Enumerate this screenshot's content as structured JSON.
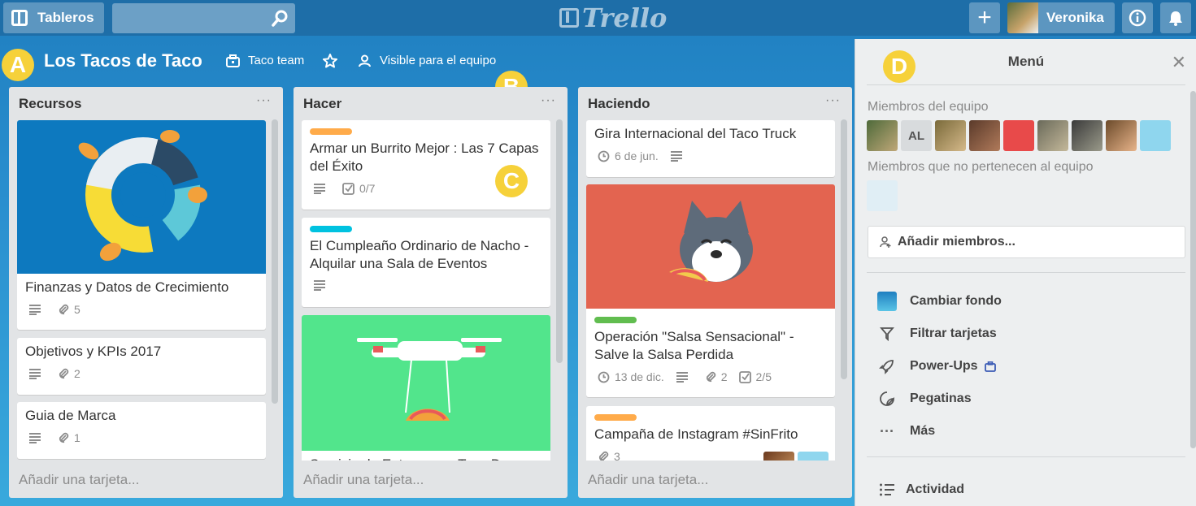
{
  "topbar": {
    "boards_label": "Tableros",
    "search_placeholder": "",
    "logo_text": "Trello",
    "user_name": "Veronika"
  },
  "board": {
    "title": "Los Tacos de Taco",
    "team": "Taco team",
    "visibility": "Visible para el equipo"
  },
  "badges": {
    "a": "A",
    "b": "B",
    "c": "C",
    "d": "D"
  },
  "lists": [
    {
      "title": "Recursos",
      "add_card": "Añadir una tarjeta...",
      "cards": [
        {
          "title": "Finanzas y Datos de Crecimiento",
          "attachments": "5"
        },
        {
          "title": "Objetivos y KPIs 2017",
          "attachments": "2"
        },
        {
          "title": "Guia de Marca",
          "attachments": "1"
        }
      ]
    },
    {
      "title": "Hacer",
      "add_card": "Añadir una tarjeta...",
      "cards": [
        {
          "title": "Armar un Burrito Mejor : Las 7 Capas del Éxito",
          "checklist": "0/7",
          "label_color": "#ffab4a"
        },
        {
          "title": "El Cumpleaño Ordinario de Nacho - Alquilar una Sala de Eventos",
          "label_color": "#00c2e0"
        },
        {
          "title": "Servicio de Entrega por Taco Drones"
        }
      ]
    },
    {
      "title": "Haciendo",
      "add_card": "Añadir una tarjeta...",
      "cards": [
        {
          "title": "Gira Internacional del Taco Truck",
          "due": "6 de jun."
        },
        {
          "title": "Operación \"Salsa Sensacional\" - Salve la Salsa Perdida",
          "due": "13 de dic.",
          "attachments": "2",
          "checklist": "2/5",
          "label_color": "#61bd4f"
        },
        {
          "title": "Campaña de Instagram #SinFrito",
          "attachments": "3",
          "label_color": "#ffab4a"
        }
      ]
    }
  ],
  "menu": {
    "title": "Menú",
    "team_members_label": "Miembros del equipo",
    "non_team_label": "Miembros que no pertenecen al equipo",
    "member_initials": "AL",
    "add_members": "Añadir miembros...",
    "items": [
      "Cambiar fondo",
      "Filtrar tarjetas",
      "Power-Ups",
      "Pegatinas",
      "Más"
    ],
    "activity": "Actividad"
  },
  "colors": {
    "badge_yellow": "#f6d13a",
    "topbar": "#1e6ea8",
    "list_bg": "#e2e4e6",
    "menu_bg": "#edeff0"
  }
}
